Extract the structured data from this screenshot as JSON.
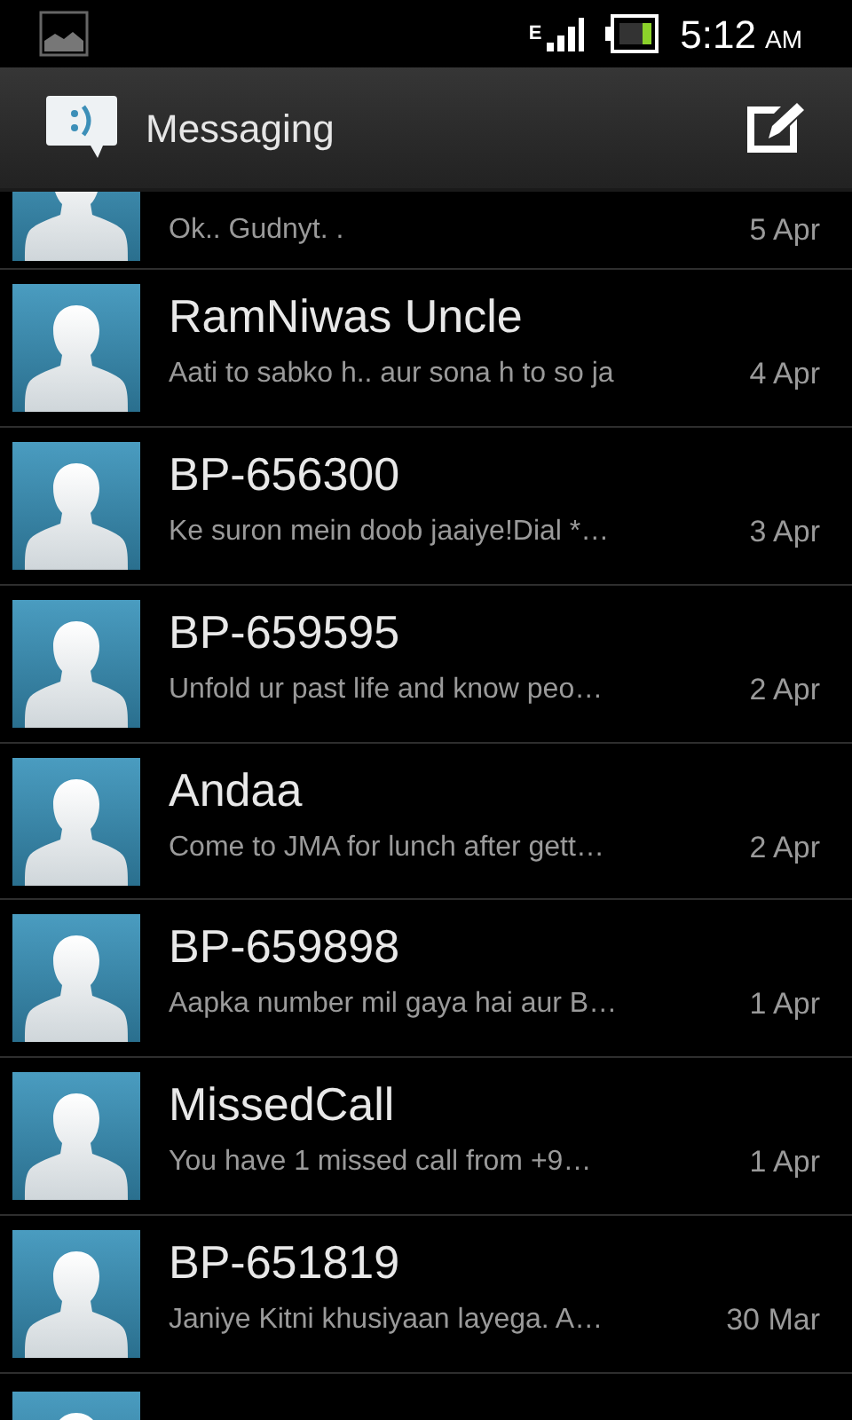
{
  "status_bar": {
    "network": "E",
    "time": "5:12",
    "meridiem": "AM"
  },
  "action_bar": {
    "title": "Messaging"
  },
  "conversations": [
    {
      "kind": "cut_top",
      "preview": "Ok.. Gudnyt. .",
      "date": "5 Apr"
    },
    {
      "kind": "full",
      "name": "RamNiwas Uncle",
      "preview": "Aati to sabko h.. aur sona h to so ja",
      "date": "4 Apr"
    },
    {
      "kind": "full",
      "name": "BP-656300",
      "preview": "Ke suron mein doob jaaiye!Dial *…",
      "date": "3 Apr"
    },
    {
      "kind": "full",
      "name": "BP-659595",
      "preview": "Unfold ur past life and know peo…",
      "date": "2 Apr"
    },
    {
      "kind": "full",
      "name": "Andaa",
      "preview": "Come to JMA for lunch after gett…",
      "date": "2 Apr"
    },
    {
      "kind": "full",
      "name": "BP-659898",
      "preview": "Aapka number mil gaya hai aur B…",
      "date": "1 Apr"
    },
    {
      "kind": "full",
      "name": "MissedCall",
      "preview": "You have 1 missed call from +9…",
      "date": "1 Apr"
    },
    {
      "kind": "full",
      "name": "BP-651819",
      "preview": "Janiye Kitni khusiyaan layega. A…",
      "date": "30 Mar"
    },
    {
      "kind": "cut_bottom"
    }
  ]
}
